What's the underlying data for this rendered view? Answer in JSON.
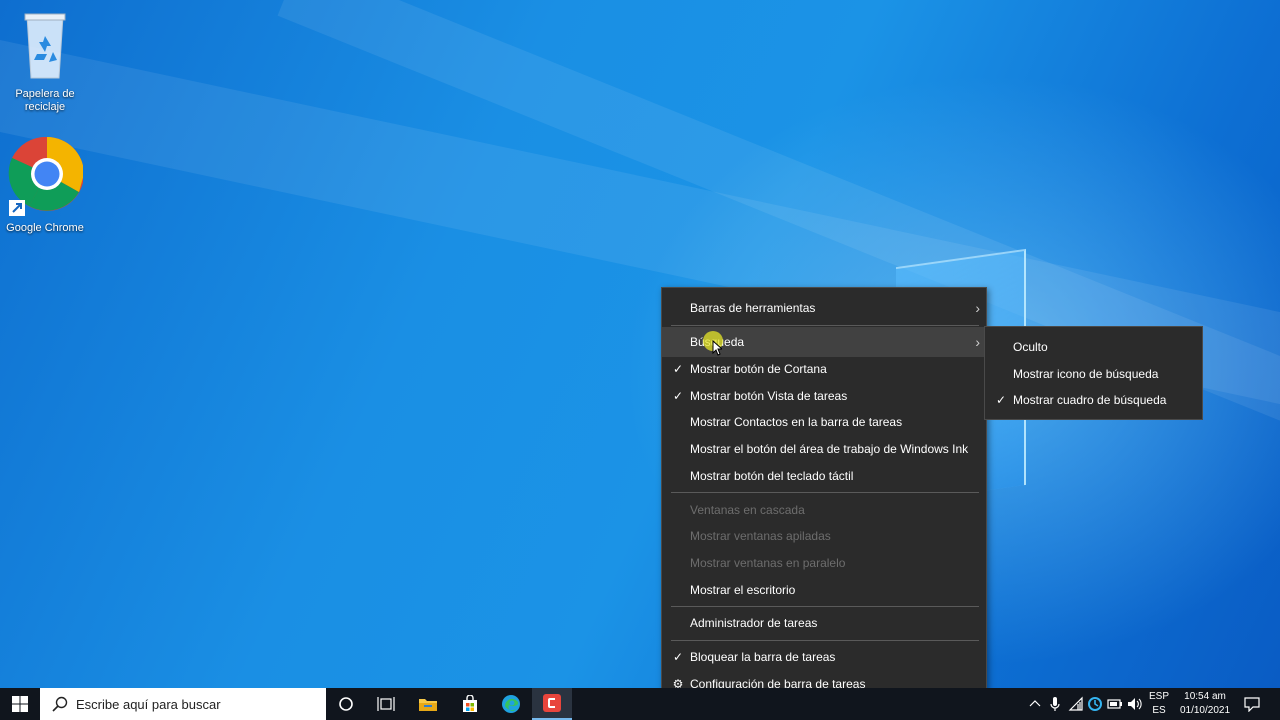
{
  "desktop": {
    "icons": [
      {
        "label": "Papelera de reciclaje"
      },
      {
        "label": "Google Chrome"
      }
    ]
  },
  "context_menu": {
    "items": [
      {
        "label": "Barras de herramientas",
        "checked": false,
        "has_submenu": true,
        "enabled": true
      },
      {
        "label": "Búsqueda",
        "checked": false,
        "has_submenu": true,
        "enabled": true,
        "hovered": true
      },
      {
        "label": "Mostrar botón de Cortana",
        "checked": true,
        "enabled": true
      },
      {
        "label": "Mostrar botón Vista de tareas",
        "checked": true,
        "enabled": true
      },
      {
        "label": "Mostrar Contactos en la barra de tareas",
        "checked": false,
        "enabled": true
      },
      {
        "label": "Mostrar el botón del área de trabajo de Windows Ink",
        "checked": false,
        "enabled": true
      },
      {
        "label": "Mostrar botón del teclado táctil",
        "checked": false,
        "enabled": true
      },
      {
        "label": "Ventanas en cascada",
        "enabled": false
      },
      {
        "label": "Mostrar ventanas apiladas",
        "enabled": false
      },
      {
        "label": "Mostrar ventanas en paralelo",
        "enabled": false
      },
      {
        "label": "Mostrar el escritorio",
        "enabled": true
      },
      {
        "label": "Administrador de tareas",
        "enabled": true
      },
      {
        "label": "Bloquear la barra de tareas",
        "checked": true,
        "enabled": true
      },
      {
        "label": "Configuración de barra de tareas",
        "icon": "gear-icon",
        "enabled": true
      }
    ]
  },
  "submenu": {
    "items": [
      {
        "label": "Oculto",
        "checked": false
      },
      {
        "label": "Mostrar icono de búsqueda",
        "checked": false
      },
      {
        "label": "Mostrar cuadro de búsqueda",
        "checked": true
      }
    ]
  },
  "taskbar": {
    "search_placeholder": "Escribe aquí para buscar",
    "apps": [
      "cortana-icon",
      "task-view-icon",
      "file-explorer-icon",
      "store-icon",
      "edge-icon",
      "camtasia-icon"
    ],
    "tray": [
      "chevron-up-icon",
      "microphone-icon",
      "network-icon",
      "cloud-sync-icon",
      "battery-icon",
      "volume-icon"
    ],
    "lang_top": "ESP",
    "lang_bottom": "ES",
    "time": "10:54 am",
    "date": "01/10/2021"
  },
  "colors": {
    "menu_bg": "#2b2b2b",
    "menu_hover": "#414141",
    "taskbar_bg": "#10151d",
    "desktop_blue": "#0a78d7"
  }
}
